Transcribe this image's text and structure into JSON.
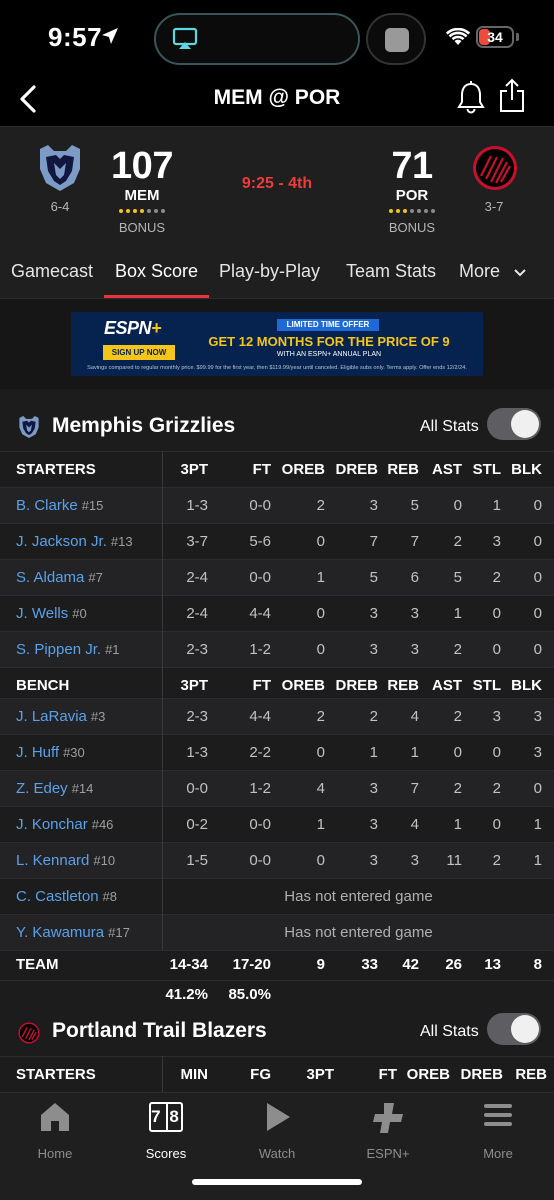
{
  "status": {
    "time": "9:57",
    "battery": "34"
  },
  "nav": {
    "title": "MEM @ POR"
  },
  "score": {
    "away": {
      "abbr": "MEM",
      "score": "107",
      "record": "6-4",
      "bonus": "BONUS"
    },
    "home": {
      "abbr": "POR",
      "score": "71",
      "record": "3-7",
      "bonus": "BONUS"
    },
    "clock": "9:25 - 4th",
    "colors": {
      "live": "#ee3b3b",
      "timeout_on": "#f0c419",
      "timeout_off": "#8a8a8a"
    }
  },
  "tabs": [
    "Gamecast",
    "Box Score",
    "Play-by-Play",
    "Team Stats",
    "More"
  ],
  "ad": {
    "brand": "ESPN+",
    "badge": "LIMITED TIME OFFER",
    "headline": "GET 12 MONTHS FOR THE PRICE OF 9",
    "sub": "WITH AN ESPN+ ANNUAL PLAN",
    "cta": "SIGN UP NOW",
    "fine": "Savings compared to regular monthly price. $99.99 for the first year, then $119.99/year until canceled. Eligible subs only. Terms apply. Offer ends 12/2/24."
  },
  "mem": {
    "name": "Memphis Grizzlies",
    "all_stats": "All Stats",
    "starters_label": "STARTERS",
    "bench_label": "BENCH",
    "columns": [
      "3PT",
      "FT",
      "OREB",
      "DREB",
      "REB",
      "AST",
      "STL",
      "BLK"
    ],
    "starters": [
      {
        "name": "B. Clarke",
        "num": "#15",
        "stats": [
          "1-3",
          "0-0",
          "2",
          "3",
          "5",
          "0",
          "1",
          "0"
        ]
      },
      {
        "name": "J. Jackson Jr.",
        "num": "#13",
        "stats": [
          "3-7",
          "5-6",
          "0",
          "7",
          "7",
          "2",
          "3",
          "0"
        ]
      },
      {
        "name": "S. Aldama",
        "num": "#7",
        "stats": [
          "2-4",
          "0-0",
          "1",
          "5",
          "6",
          "5",
          "2",
          "0"
        ]
      },
      {
        "name": "J. Wells",
        "num": "#0",
        "stats": [
          "2-4",
          "4-4",
          "0",
          "3",
          "3",
          "1",
          "0",
          "0"
        ]
      },
      {
        "name": "S. Pippen Jr.",
        "num": "#1",
        "stats": [
          "2-3",
          "1-2",
          "0",
          "3",
          "3",
          "2",
          "0",
          "0"
        ]
      }
    ],
    "bench": [
      {
        "name": "J. LaRavia",
        "num": "#3",
        "stats": [
          "2-3",
          "4-4",
          "2",
          "2",
          "4",
          "2",
          "3",
          "3"
        ]
      },
      {
        "name": "J. Huff",
        "num": "#30",
        "stats": [
          "1-3",
          "2-2",
          "0",
          "1",
          "1",
          "0",
          "0",
          "3"
        ]
      },
      {
        "name": "Z. Edey",
        "num": "#14",
        "stats": [
          "0-0",
          "1-2",
          "4",
          "3",
          "7",
          "2",
          "2",
          "0"
        ]
      },
      {
        "name": "J. Konchar",
        "num": "#46",
        "stats": [
          "0-2",
          "0-0",
          "1",
          "3",
          "4",
          "1",
          "0",
          "1"
        ]
      },
      {
        "name": "L. Kennard",
        "num": "#10",
        "stats": [
          "1-5",
          "0-0",
          "0",
          "3",
          "3",
          "11",
          "2",
          "1"
        ]
      }
    ],
    "dnp": [
      {
        "name": "C. Castleton",
        "num": "#8",
        "text": "Has not entered game"
      },
      {
        "name": "Y. Kawamura",
        "num": "#17",
        "text": "Has not entered game"
      }
    ],
    "team_label": "TEAM",
    "team_totals": [
      "14-34",
      "17-20",
      "9",
      "33",
      "42",
      "26",
      "13",
      "8"
    ],
    "team_pct": [
      "41.2%",
      "85.0%"
    ]
  },
  "por": {
    "name": "Portland Trail Blazers",
    "all_stats": "All Stats",
    "starters_label": "STARTERS",
    "columns": [
      "MIN",
      "FG",
      "3PT",
      "FT",
      "OREB",
      "DREB",
      "REB"
    ]
  },
  "bottom_tabs": [
    "Home",
    "Scores",
    "Watch",
    "ESPN+",
    "More"
  ],
  "scores_icon_text": "7 8"
}
